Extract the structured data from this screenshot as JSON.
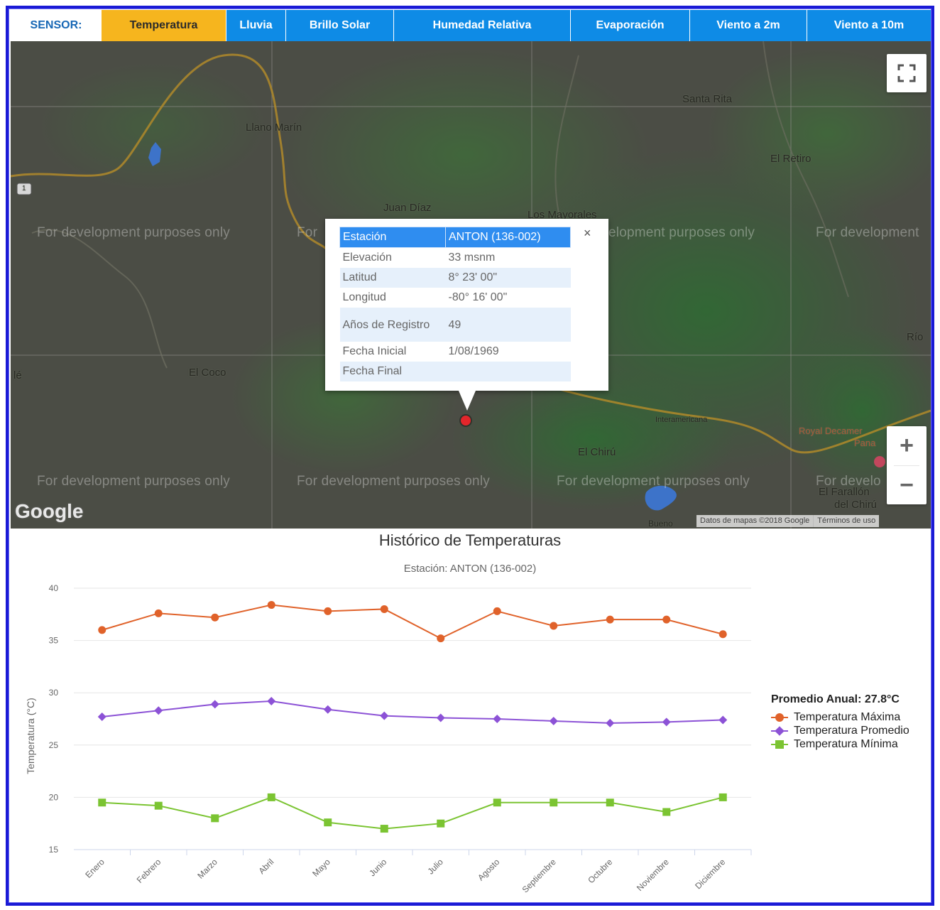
{
  "tabs": {
    "sensor_label": "SENSOR:",
    "items": [
      {
        "label": "Temperatura",
        "active": true
      },
      {
        "label": "Lluvia"
      },
      {
        "label": "Brillo Solar"
      },
      {
        "label": "Humedad Relativa"
      },
      {
        "label": "Evaporación"
      },
      {
        "label": "Viento a 2m"
      },
      {
        "label": "Viento a 10m"
      }
    ]
  },
  "map": {
    "places": {
      "santa_rita": "Santa Rita",
      "llano_marin": "Llano Marín",
      "el_retiro": "El Retiro",
      "juan_diaz": "Juan Díaz",
      "los_mayorales": "Los Mayorales",
      "rio": "Río",
      "el_coco": "El Coco",
      "le": "lé",
      "interamericana": "Interamericana",
      "royal_decameron": "Royal Decamer",
      "panama": "Pana",
      "el_chiru": "El Chirú",
      "el_farallon": "El Farallón",
      "del_chiru": "del Chirú",
      "bueno": "Bueno",
      "route_1": "1"
    },
    "watermark": "For development purposes only",
    "watermark_cut": "For",
    "watermark_right": "For development",
    "watermark_right_bottom": "For develo",
    "watermark_left_fragment": "elopment purposes only",
    "google_logo": "Google",
    "attribution_data": "Datos de mapas ©2018 Google",
    "attribution_terms": "Términos de uso",
    "zoom_in": "+",
    "zoom_out": "−"
  },
  "info_window": {
    "close": "×",
    "rows": [
      {
        "key": "Estación",
        "value": "ANTON (136-002)"
      },
      {
        "key": "Elevación",
        "value": "33 msnm"
      },
      {
        "key": "Latitud",
        "value": "8° 23' 00\""
      },
      {
        "key": "Longitud",
        "value": "-80° 16' 00\""
      },
      {
        "key": "Años de Registro",
        "value": "49"
      },
      {
        "key": "Fecha Inicial",
        "value": "1/08/1969"
      },
      {
        "key": "Fecha Final",
        "value": ""
      }
    ]
  },
  "chart_data": {
    "type": "line",
    "title": "Histórico de Temperaturas",
    "subtitle": "Estación: ANTON (136-002)",
    "ylabel": "Temperatura (°C)",
    "xlabel": "",
    "ylim": [
      15,
      40
    ],
    "yticks": [
      15,
      20,
      25,
      30,
      35,
      40
    ],
    "grid": true,
    "legend_position": "right",
    "legend_title": "Promedio Anual: 27.8°C",
    "categories": [
      "Enero",
      "Febrero",
      "Marzo",
      "Abril",
      "Mayo",
      "Junio",
      "Julio",
      "Agosto",
      "Septiembre",
      "Octubre",
      "Noviembre",
      "Diciembre"
    ],
    "series": [
      {
        "name": "Temperatura Máxima",
        "color": "#e0622a",
        "marker": "circle",
        "values": [
          36.0,
          37.6,
          37.2,
          38.4,
          37.8,
          38.0,
          35.2,
          37.8,
          36.4,
          37.0,
          37.0,
          35.6
        ]
      },
      {
        "name": "Temperatura Promedio",
        "color": "#8c52d6",
        "marker": "diamond",
        "values": [
          27.7,
          28.3,
          28.9,
          29.2,
          28.4,
          27.8,
          27.6,
          27.5,
          27.3,
          27.1,
          27.2,
          27.4
        ]
      },
      {
        "name": "Temperatura Mínima",
        "color": "#7bc432",
        "marker": "square",
        "values": [
          19.5,
          19.2,
          18.0,
          20.0,
          17.6,
          17.0,
          17.5,
          19.5,
          19.5,
          19.5,
          18.6,
          20.0
        ]
      }
    ]
  }
}
